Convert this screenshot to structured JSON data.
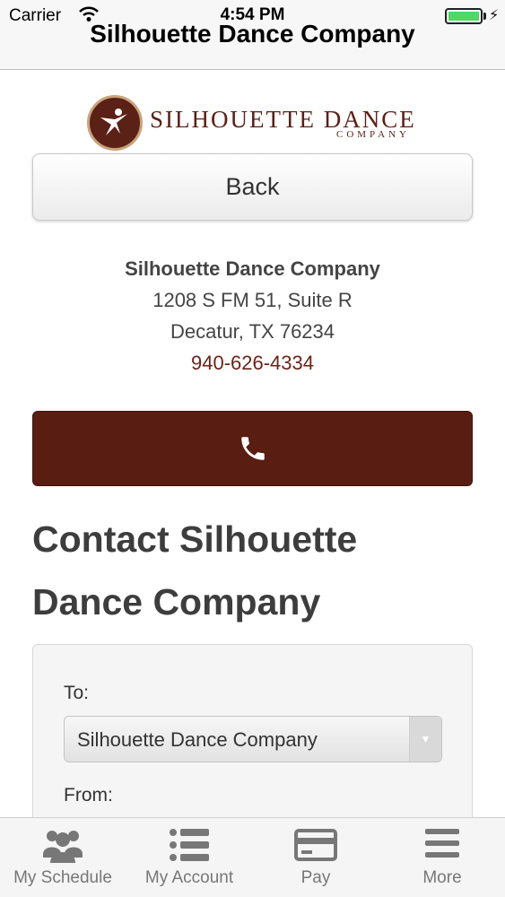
{
  "status_bar": {
    "carrier": "Carrier",
    "time": "4:54 PM"
  },
  "nav": {
    "title": "Silhouette Dance Company"
  },
  "logo": {
    "main_text": "SILHOUETTE DANCE",
    "sub_text": "COMPANY"
  },
  "back_button": {
    "label": "Back"
  },
  "address": {
    "name": "Silhouette Dance Company",
    "street": "1208 S FM 51, Suite R",
    "city": "Decatur, TX 76234",
    "phone": "940-626-4334"
  },
  "call_button": {
    "icon": "phone-icon"
  },
  "contact": {
    "heading_line1": "Contact Silhouette",
    "heading_line2": "Dance Company"
  },
  "form": {
    "to_label": "To:",
    "to_selected": "Silhouette Dance Company",
    "from_label": "From:"
  },
  "tabbar": {
    "tabs": [
      {
        "label": "My Schedule",
        "icon": "people-icon"
      },
      {
        "label": "My Account",
        "icon": "list-icon"
      },
      {
        "label": "Pay",
        "icon": "credit-card-icon"
      },
      {
        "label": "More",
        "icon": "menu-icon"
      }
    ]
  },
  "colors": {
    "brand": "#5a1d12",
    "battery": "#4cd964"
  }
}
